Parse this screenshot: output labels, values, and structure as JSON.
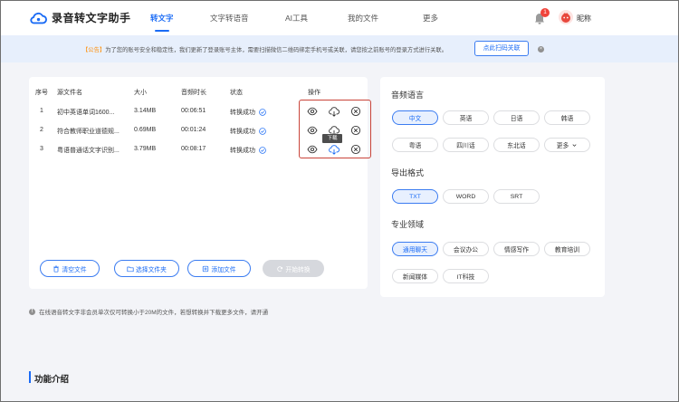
{
  "app": {
    "title": "录音转文字助手"
  },
  "nav": [
    "转文字",
    "文字转语音",
    "AI工具",
    "我的文件",
    "更多"
  ],
  "user": {
    "notification_count": "1",
    "nickname": "昵称"
  },
  "notice": {
    "tag": "【公告】",
    "text": "为了您的账号安全和稳定性，我们更新了登录账号主体，需要扫描微信二维码绑定手机号或关联，请您按之前账号的登录方式进行关联。",
    "button": "点此扫码关联"
  },
  "table": {
    "headers": [
      "序号",
      "源文件名",
      "大小",
      "音频时长",
      "状态",
      "操作"
    ],
    "rows": [
      {
        "index": "1",
        "name": "初中英语单词1600...",
        "size": "3.14MB",
        "duration": "00:06:51",
        "status": "转换成功"
      },
      {
        "index": "2",
        "name": "符合教师职业道德规...",
        "size": "0.69MB",
        "duration": "00:01:24",
        "status": "转换成功"
      },
      {
        "index": "3",
        "name": "粤语普通话文字识别...",
        "size": "3.79MB",
        "duration": "00:08:17",
        "status": "转换成功"
      }
    ],
    "tooltip": "下载"
  },
  "buttons": {
    "clear": "清空文件",
    "select_folder": "选择文件夹",
    "add_file": "添加文件",
    "start": "开始转换"
  },
  "settings": {
    "language_title": "音频语言",
    "languages": [
      "中文",
      "英语",
      "日语",
      "韩语",
      "粤语",
      "四川话",
      "东北话",
      "更多"
    ],
    "format_title": "导出格式",
    "formats": [
      "TXT",
      "WORD",
      "SRT"
    ],
    "domain_title": "专业领域",
    "domains": [
      "通用聊天",
      "会议办公",
      "情感写作",
      "教育培训",
      "新闻媒体",
      "IT科技"
    ]
  },
  "tip": "在线语音转文字非会员单次仅可转换小于20M的文件，若想转换并下载更多文件，请开通",
  "section": {
    "title": "功能介绍"
  },
  "colors": {
    "accent": "#1a6bf5",
    "highlight_border": "#c9443a",
    "notice_bg": "#e7effc",
    "page_bg": "#f3f4f8"
  }
}
